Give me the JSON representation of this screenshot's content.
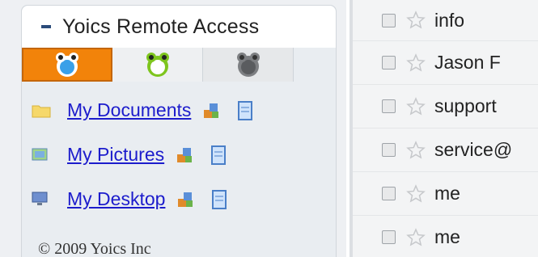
{
  "gadget": {
    "title": "Yoics Remote Access",
    "tabs": [
      {
        "name": "blue-status-tab",
        "active": true
      },
      {
        "name": "green-status-tab",
        "active": false
      },
      {
        "name": "gray-status-tab",
        "active": false
      }
    ],
    "links": [
      {
        "label": "My Documents"
      },
      {
        "label": "My Pictures"
      },
      {
        "label": "My Desktop"
      }
    ],
    "copyright": "© 2009 Yoics Inc"
  },
  "mail": {
    "rows": [
      {
        "sender": "info"
      },
      {
        "sender": "Jason F"
      },
      {
        "sender": "support"
      },
      {
        "sender": "service@"
      },
      {
        "sender": "me"
      },
      {
        "sender": "me"
      }
    ]
  },
  "colors": {
    "accent_orange": "#f2830a",
    "link_blue": "#1c1ccc"
  }
}
